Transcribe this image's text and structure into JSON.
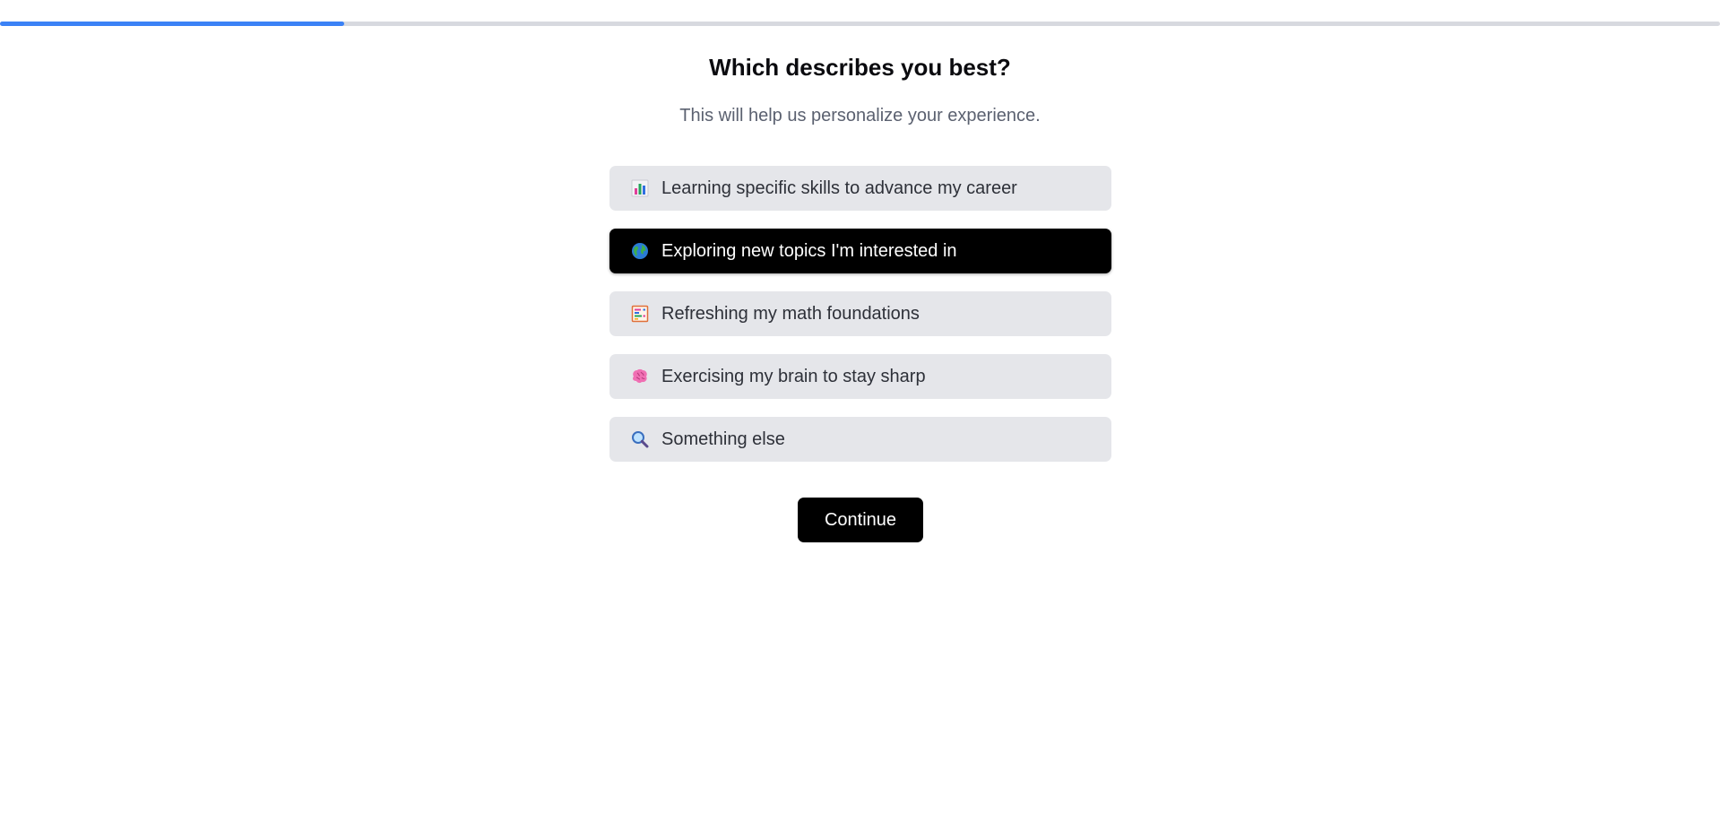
{
  "progress": {
    "fraction": 0.2,
    "track_color": "#d7d9df",
    "fill_color": "#3b82f6"
  },
  "header": {
    "title": "Which describes you best?",
    "subtitle": "This will help us personalize your experience."
  },
  "options": [
    {
      "label": "Learning specific skills to advance my career",
      "icon": "bar-chart-icon",
      "selected": false
    },
    {
      "label": "Exploring new topics I'm interested in",
      "icon": "globe-icon",
      "selected": true
    },
    {
      "label": "Refreshing my math foundations",
      "icon": "abacus-icon",
      "selected": false
    },
    {
      "label": "Exercising my brain to stay sharp",
      "icon": "brain-icon",
      "selected": false
    },
    {
      "label": "Something else",
      "icon": "magnifier-icon",
      "selected": false
    }
  ],
  "actions": {
    "continue_label": "Continue"
  },
  "colors": {
    "selected_bg": "#000000",
    "option_bg": "#e5e6ea",
    "accent": "#3b82f6"
  }
}
